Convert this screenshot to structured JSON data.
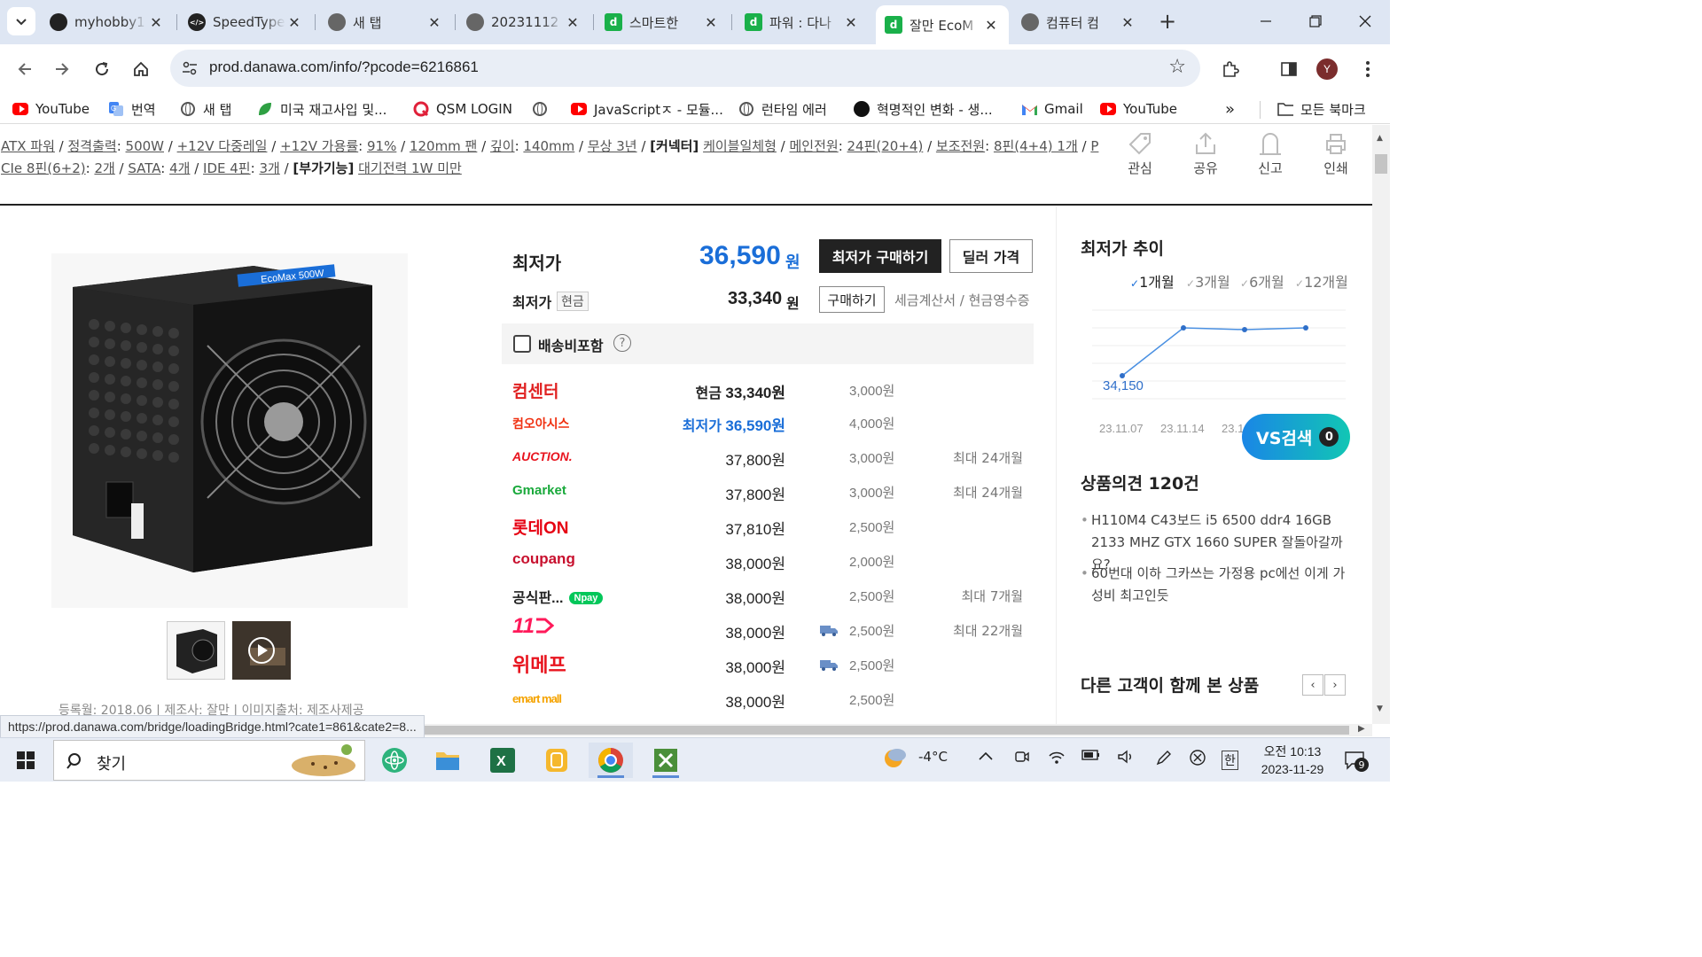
{
  "browser": {
    "tabs": [
      {
        "title": "myhobby1",
        "icon": "github-icon",
        "active": false
      },
      {
        "title": "SpeedType",
        "icon": "code-icon",
        "active": false
      },
      {
        "title": "새 탭",
        "icon": "chrome-icon",
        "active": false
      },
      {
        "title": "20231112",
        "icon": "globe-icon",
        "active": false
      },
      {
        "title": "스마트한 ",
        "icon": "danawa-icon",
        "active": false
      },
      {
        "title": "파워 : 다나",
        "icon": "danawa-icon",
        "active": false
      },
      {
        "title": "잘만 EcoM",
        "icon": "danawa-icon",
        "active": true
      },
      {
        "title": "컴퓨터 컴",
        "icon": "globe-icon",
        "active": false
      }
    ],
    "url": "prod.danawa.com/info/?pcode=6216861",
    "profile_initial": "Y",
    "bookmarks": [
      {
        "label": "YouTube",
        "icon": "youtube-icon"
      },
      {
        "label": "번역",
        "icon": "translate-icon"
      },
      {
        "label": "새 탭",
        "icon": "globe-icon"
      },
      {
        "label": "미국 재고사입 및...",
        "icon": "leaf-icon"
      },
      {
        "label": "QSM LOGIN",
        "icon": "q-icon"
      },
      {
        "label": "",
        "icon": "globe-icon"
      },
      {
        "label": "JavaScriptㅈ - 모듈...",
        "icon": "youtube-icon"
      },
      {
        "label": "런타임 에러",
        "icon": "globe-icon"
      },
      {
        "label": "혁명적인 변화 - 생...",
        "icon": "circle-icon"
      },
      {
        "label": "Gmail",
        "icon": "gmail-icon"
      },
      {
        "label": "YouTube",
        "icon": "youtube-icon"
      }
    ],
    "all_bookmarks": "모든 북마크",
    "status_url": "https://prod.danawa.com/bridge/loadingBridge.html?cate1=861&cate2=8..."
  },
  "spec": {
    "line1": [
      {
        "t": "ATX 파워",
        "link": true
      },
      {
        "t": " / ",
        "link": false
      },
      {
        "t": "정격출력",
        "link": true
      },
      {
        "t": ": ",
        "link": false
      },
      {
        "t": "500W",
        "link": true
      },
      {
        "t": " / ",
        "link": false
      },
      {
        "t": "+12V 다중레일",
        "link": true
      },
      {
        "t": " / ",
        "link": false
      },
      {
        "t": "+12V 가용률",
        "link": true
      },
      {
        "t": ": ",
        "link": false
      },
      {
        "t": "91%",
        "link": true
      },
      {
        "t": " / ",
        "link": false
      },
      {
        "t": "120mm 팬",
        "link": true
      },
      {
        "t": " / ",
        "link": false
      },
      {
        "t": "깊이",
        "link": true
      },
      {
        "t": ": ",
        "link": false
      },
      {
        "t": "140mm",
        "link": true
      },
      {
        "t": " / ",
        "link": false
      },
      {
        "t": "무상 3년",
        "link": true
      },
      {
        "t": " / ",
        "link": false
      },
      {
        "t": "[커넥터]",
        "bold": true
      },
      {
        "t": " ",
        "link": false
      },
      {
        "t": "케이블일체형",
        "link": true
      },
      {
        "t": " / ",
        "link": false
      },
      {
        "t": "메인전원",
        "link": true
      },
      {
        "t": ": ",
        "link": false
      },
      {
        "t": "24핀(20+4)",
        "link": true
      },
      {
        "t": " / ",
        "link": false
      },
      {
        "t": "보조전원",
        "link": true
      },
      {
        "t": ": ",
        "link": false
      },
      {
        "t": "8핀(4+4) 1개",
        "link": true
      },
      {
        "t": " / ",
        "link": false
      },
      {
        "t": "P",
        "link": true
      }
    ],
    "line2": [
      {
        "t": "CIe 8핀(6+2)",
        "link": true
      },
      {
        "t": ": ",
        "link": false
      },
      {
        "t": "2개",
        "link": true
      },
      {
        "t": " / ",
        "link": false
      },
      {
        "t": "SATA",
        "link": true
      },
      {
        "t": ": ",
        "link": false
      },
      {
        "t": "4개",
        "link": true
      },
      {
        "t": " / ",
        "link": false
      },
      {
        "t": "IDE 4핀",
        "link": true
      },
      {
        "t": ": ",
        "link": false
      },
      {
        "t": "3개",
        "link": true
      },
      {
        "t": " / ",
        "link": false
      },
      {
        "t": "[부가기능]",
        "bold": true
      },
      {
        "t": " ",
        "link": false
      },
      {
        "t": "대기전력 1W 미만",
        "link": true
      }
    ]
  },
  "actions": [
    {
      "label": "관심",
      "icon": "tag-icon"
    },
    {
      "label": "공유",
      "icon": "share-icon"
    },
    {
      "label": "신고",
      "icon": "report-icon"
    },
    {
      "label": "인쇄",
      "icon": "print-icon"
    }
  ],
  "product": {
    "reg_info": "등록월: 2018.06   |   제조사: 잘만   |   이미지출처: 제조사제공",
    "image_brand_text": "EcoMax 500W"
  },
  "price": {
    "lowest_label": "최저가",
    "lowest_value": "36,590",
    "won": "원",
    "buy_btn": "최저가 구매하기",
    "dealer_btn": "딜러 가격",
    "cash_label": "최저가",
    "cash_tag": "현금",
    "cash_value": "33,340",
    "buy_small": "구매하기",
    "receipt": "세금계산서 / 현금영수증",
    "shipping_label": "배송비포함",
    "help": "?"
  },
  "shops": [
    {
      "name": "컴센터",
      "color": "#e02020",
      "style": "ko",
      "price_prefix": "현금",
      "price": "33,340원",
      "prefix_color": "#222",
      "bold": true,
      "ship": "3,000원",
      "truck": false,
      "inst": ""
    },
    {
      "name": "컴오아시스",
      "color": "#f03010",
      "style": "ko-small",
      "price_prefix": "최저가",
      "price": "36,590원",
      "prefix_color": "#1a6ed8",
      "bold": true,
      "blue": true,
      "ship": "4,000원",
      "truck": false,
      "inst": ""
    },
    {
      "name": "AUCTION.",
      "color": "#e8141e",
      "style": "auction",
      "price_prefix": "",
      "price": "37,800원",
      "ship": "3,000원",
      "truck": false,
      "inst": "최대 24개월"
    },
    {
      "name": "Gmarket",
      "color": "#19a93b",
      "style": "gmarket",
      "price_prefix": "",
      "price": "37,800원",
      "ship": "3,000원",
      "truck": false,
      "inst": "최대 24개월"
    },
    {
      "name": "롯데ON",
      "color": "#e60012",
      "style": "lotte",
      "price_prefix": "",
      "price": "37,810원",
      "ship": "2,500원",
      "truck": false,
      "inst": ""
    },
    {
      "name": "coupang",
      "color": "#c8102e",
      "style": "coupang",
      "price_prefix": "",
      "price": "38,000원",
      "ship": "2,000원",
      "truck": false,
      "inst": ""
    },
    {
      "name": "공식판...",
      "color": "#222",
      "style": "official",
      "badge": "Npay",
      "price_prefix": "",
      "price": "38,000원",
      "ship": "2,500원",
      "truck": false,
      "inst": "최대 7개월"
    },
    {
      "name": "11",
      "color": "#ff1a5a",
      "style": "11st",
      "price_prefix": "",
      "price": "38,000원",
      "ship": "2,500원",
      "truck": true,
      "inst": "최대 22개월"
    },
    {
      "name": "위메프",
      "color": "#e8141e",
      "style": "wemakeprice",
      "price_prefix": "",
      "price": "38,000원",
      "ship": "2,500원",
      "truck": true,
      "inst": ""
    },
    {
      "name": "emart mall",
      "color": "#f5a300",
      "style": "emart",
      "price_prefix": "",
      "price": "38,000원",
      "ship": "2,500원",
      "truck": false,
      "inst": ""
    }
  ],
  "trend": {
    "title": "최저가 추이",
    "periods": [
      {
        "label": "1개월",
        "selected": true
      },
      {
        "label": "3개월",
        "selected": false
      },
      {
        "label": "6개월",
        "selected": false
      },
      {
        "label": "12개월",
        "selected": false
      }
    ],
    "point_label": "34,150",
    "x_labels": [
      "23.11.07",
      "23.11.14",
      "23.1"
    ],
    "values": [
      34150,
      35500,
      35450,
      35500
    ],
    "vs_label": "VS검색",
    "vs_count": "0"
  },
  "opinions": {
    "title": "상품의견 120건",
    "items": [
      "H110M4 C43보드 i5 6500 ddr4 16GB 2133 MHZ GTX 1660 SUPER 잘돌아갈까요?",
      "60번대 이하 그카쓰는 가정용 pc에선 이게 가성비 최고인듯"
    ]
  },
  "others_title": "다른 고객이 함께 본 상품",
  "taskbar": {
    "search_placeholder": "찾기",
    "weather": "-4°C",
    "ime": "한",
    "time": "오전 10:13",
    "date": "2023-11-29",
    "notif_count": "9"
  }
}
